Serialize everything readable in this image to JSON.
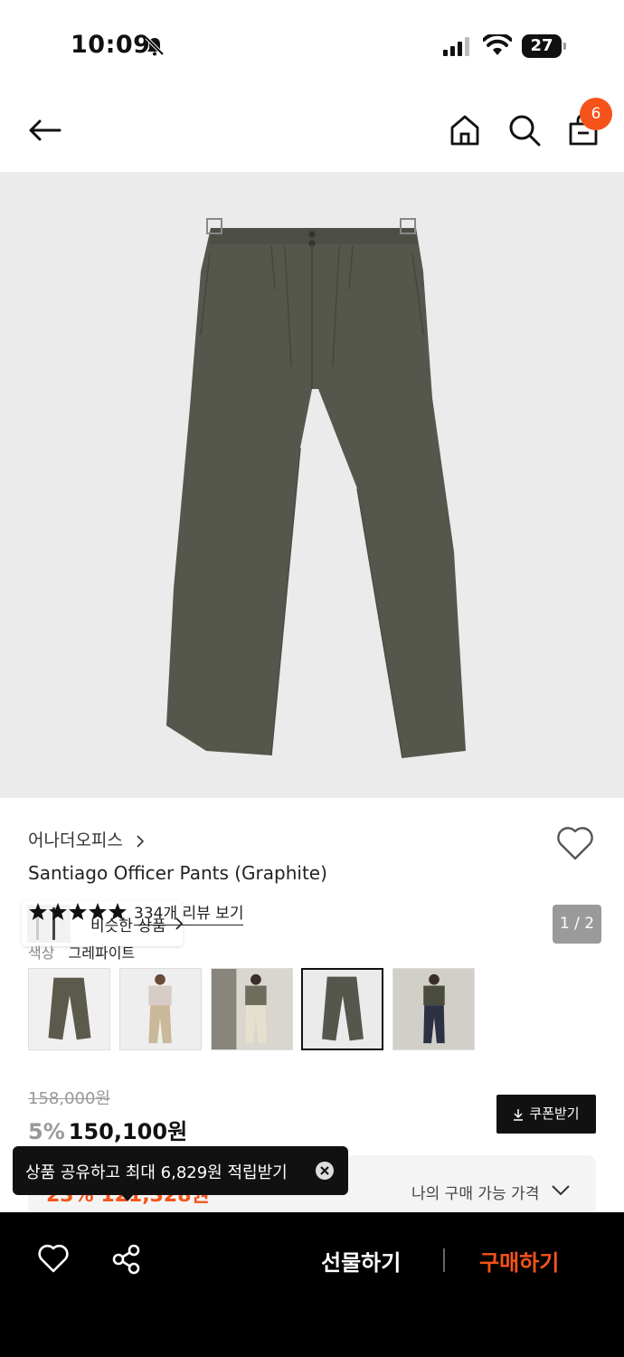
{
  "status_bar": {
    "time": "10:09",
    "battery": "27"
  },
  "nav": {
    "cart_count": "6",
    "icons": [
      "back-arrow-icon",
      "home-icon",
      "search-icon",
      "shopping-bag-icon"
    ]
  },
  "gallery": {
    "similar_label": "비슷한 상품",
    "counter": "1 / 2"
  },
  "product": {
    "brand": "어나더오피스",
    "title": "Santiago Officer Pants (Graphite)",
    "rating_stars": 5,
    "review_link": "334개 리뷰 보기",
    "color_label": "색상",
    "color_value": "그레파이트",
    "swatch_count": 5,
    "selected_swatch": 4
  },
  "pricing": {
    "original_price": "158,000원",
    "discount": "5%",
    "sale_price": "150,100원",
    "coupon_label": "쿠폰받기",
    "my_price_label": "나의 구매 가능 가격",
    "hidden_price": "23% 121,328원"
  },
  "toast": {
    "text": "상품 공유하고 최대 6,829원 적립받기"
  },
  "bottom_bar": {
    "gift_label": "선물하기",
    "buy_label": "구매하기"
  },
  "colors": {
    "accent": "#f5531a",
    "pants": "#55574d",
    "image_bg": "#ebebeb"
  }
}
